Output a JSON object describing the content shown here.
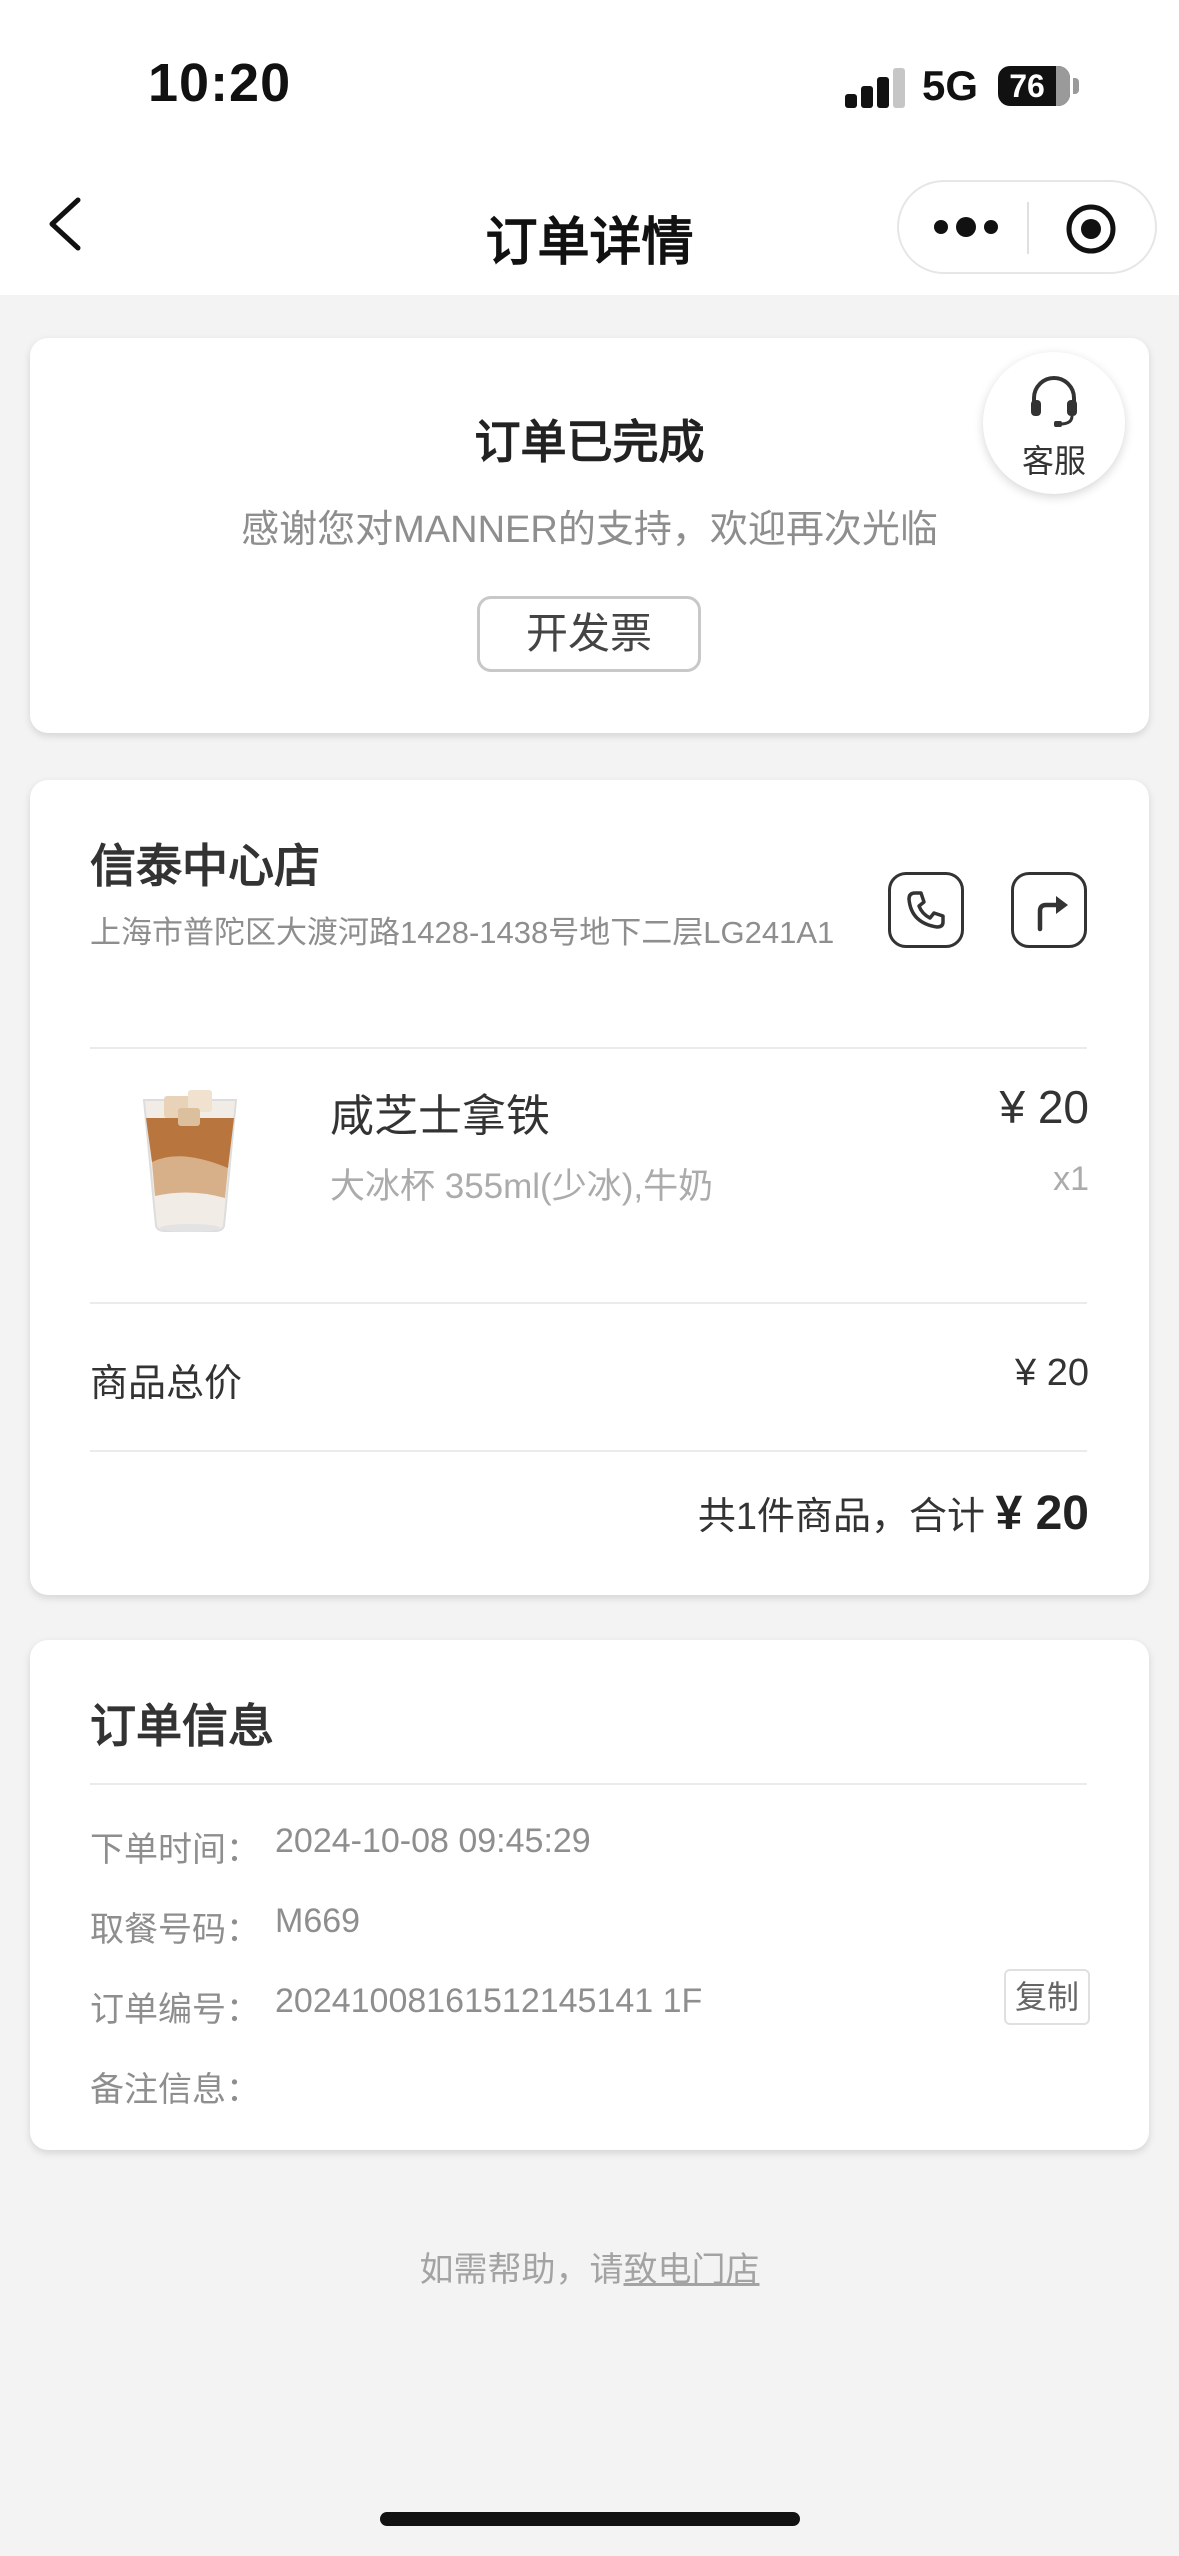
{
  "status_bar": {
    "time": "10:20",
    "network": "5G",
    "battery": "76"
  },
  "nav": {
    "title": "订单详情",
    "back_icon": "chevron-left-icon",
    "more_icon": "more-dots-icon",
    "close_icon": "target-circle-icon"
  },
  "order_status": {
    "title": "订单已完成",
    "subtitle": "感谢您对MANNER的支持，欢迎再次光临",
    "invoice_label": "开发票",
    "service_label": "客服",
    "service_icon": "headset-icon"
  },
  "store": {
    "name": "信泰中心店",
    "address": "上海市普陀区大渡河路1428-1438号地下二层LG241A1",
    "call_icon": "phone-icon",
    "navigate_icon": "direction-arrow-icon"
  },
  "product": {
    "name": "咸芝士拿铁",
    "spec": "大冰杯 355ml(少冰),牛奶",
    "price": "¥ 20",
    "quantity": "x1"
  },
  "summary": {
    "subtotal_label": "商品总价",
    "subtotal_value": "¥ 20",
    "total_text": "共1件商品，合计",
    "total_amount": "¥ 20"
  },
  "order_info": {
    "title": "订单信息",
    "rows": [
      {
        "label": "下单时间：",
        "value": "2024-10-08 09:45:29"
      },
      {
        "label": "取餐号码：",
        "value": "M669"
      },
      {
        "label": "订单编号：",
        "value": "20241008161512145141 1F"
      },
      {
        "label": "备注信息：",
        "value": ""
      }
    ],
    "copy_label": "复制"
  },
  "footer": {
    "help_text": "如需帮助，请",
    "help_link": "致电门店"
  },
  "colors": {
    "background": "#f3f3f3",
    "card": "#ffffff",
    "primary_text": "#333333",
    "secondary_text": "#8e8e8e"
  }
}
